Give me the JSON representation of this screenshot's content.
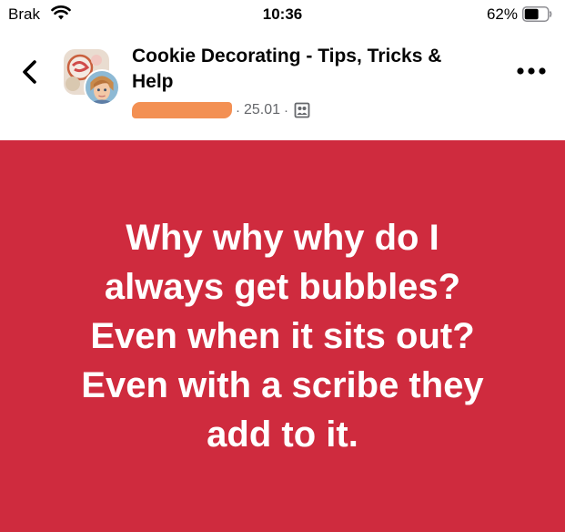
{
  "status_bar": {
    "carrier": "Brak",
    "time": "10:36",
    "battery_percent": "62%",
    "battery_level": 0.62
  },
  "header": {
    "group_name": "Cookie Decorating - Tips, Tricks & Help",
    "date": "25.01",
    "separator": "·",
    "icons": [
      "back-chevron-icon",
      "group-avatar",
      "user-avatar",
      "audience-icon",
      "more-options-icon"
    ]
  },
  "post": {
    "text": "Why why why do I\nalways get bubbles?\nEven when it sits out?\nEven with a scribe they\nadd to it.",
    "background_color": "#cf2b3e",
    "text_color": "#ffffff"
  }
}
